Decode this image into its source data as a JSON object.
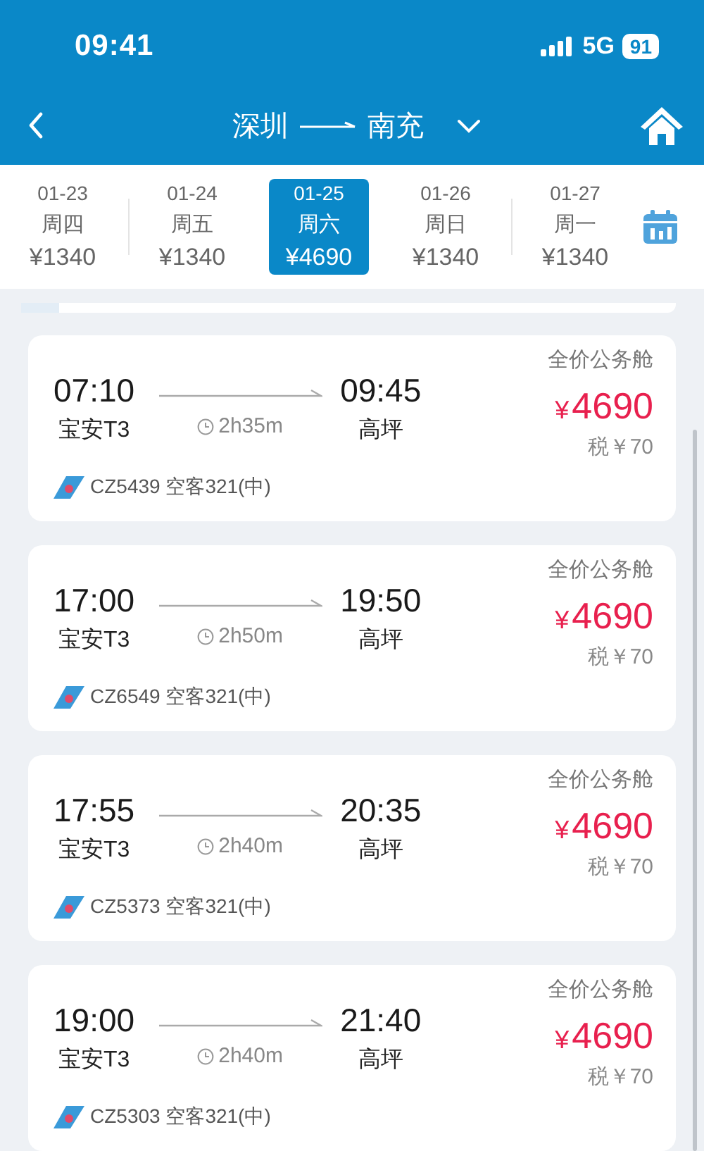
{
  "status_bar": {
    "time": "09:41",
    "network": "5G",
    "battery": "91"
  },
  "nav": {
    "from": "深圳",
    "to": "南充"
  },
  "dates": [
    {
      "date": "01-23",
      "weekday": "周四",
      "price": "¥1340",
      "selected": false
    },
    {
      "date": "01-24",
      "weekday": "周五",
      "price": "¥1340",
      "selected": false
    },
    {
      "date": "01-25",
      "weekday": "周六",
      "price": "¥4690",
      "selected": true
    },
    {
      "date": "01-26",
      "weekday": "周日",
      "price": "¥1340",
      "selected": false
    },
    {
      "date": "01-27",
      "weekday": "周一",
      "price": "¥1340",
      "selected": false
    }
  ],
  "flights": [
    {
      "depart": "07:10",
      "depart_airport": "宝安T3",
      "duration": "2h35m",
      "arrive": "09:45",
      "arrive_airport": "高坪",
      "cabin": "全价公务舱",
      "currency": "¥",
      "amount": "4690",
      "tax": "税￥70",
      "flight": "CZ5439 空客321(中)"
    },
    {
      "depart": "17:00",
      "depart_airport": "宝安T3",
      "duration": "2h50m",
      "arrive": "19:50",
      "arrive_airport": "高坪",
      "cabin": "全价公务舱",
      "currency": "¥",
      "amount": "4690",
      "tax": "税￥70",
      "flight": "CZ6549 空客321(中)"
    },
    {
      "depart": "17:55",
      "depart_airport": "宝安T3",
      "duration": "2h40m",
      "arrive": "20:35",
      "arrive_airport": "高坪",
      "cabin": "全价公务舱",
      "currency": "¥",
      "amount": "4690",
      "tax": "税￥70",
      "flight": "CZ5373 空客321(中)"
    },
    {
      "depart": "19:00",
      "depart_airport": "宝安T3",
      "duration": "2h40m",
      "arrive": "21:40",
      "arrive_airport": "高坪",
      "cabin": "全价公务舱",
      "currency": "¥",
      "amount": "4690",
      "tax": "税￥70",
      "flight": "CZ5303 空客321(中)"
    }
  ]
}
